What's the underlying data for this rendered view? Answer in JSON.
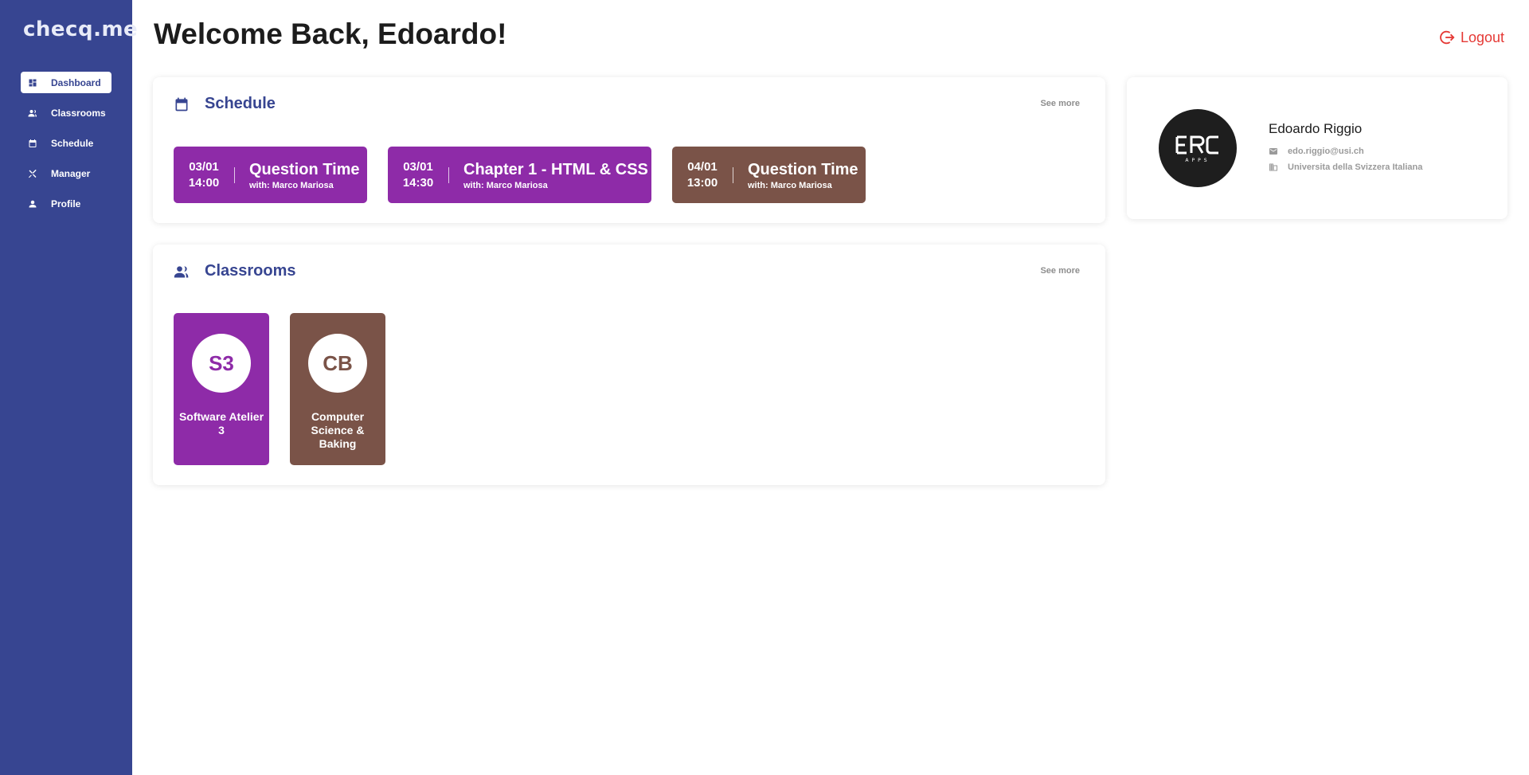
{
  "app": {
    "logo": "checq.me"
  },
  "sidebar": {
    "items": [
      {
        "label": "Dashboard",
        "icon": "dashboard-icon",
        "active": true
      },
      {
        "label": "Classrooms",
        "icon": "people-icon",
        "active": false
      },
      {
        "label": "Schedule",
        "icon": "calendar-icon",
        "active": false
      },
      {
        "label": "Manager",
        "icon": "tools-icon",
        "active": false
      },
      {
        "label": "Profile",
        "icon": "person-icon",
        "active": false
      }
    ]
  },
  "header": {
    "title": "Welcome Back, Edoardo!",
    "logout_label": "Logout"
  },
  "schedule": {
    "title": "Schedule",
    "see_more": "See more",
    "items": [
      {
        "date": "03/01",
        "time": "14:00",
        "name": "Question Time",
        "with": "with: Marco Mariosa",
        "color": "#8e2ba8"
      },
      {
        "date": "03/01",
        "time": "14:30",
        "name": "Chapter 1 - HTML & CSS",
        "with": "with: Marco Mariosa",
        "color": "#8e2ba8"
      },
      {
        "date": "04/01",
        "time": "13:00",
        "name": "Question Time",
        "with": "with: Marco Mariosa",
        "color": "#7a5348"
      }
    ]
  },
  "classrooms": {
    "title": "Classrooms",
    "see_more": "See more",
    "items": [
      {
        "abbr": "S3",
        "name": "Software Atelier 3",
        "color": "#8e2ba8"
      },
      {
        "abbr": "CB",
        "name": "Computer Science & Baking",
        "color": "#7a5348"
      }
    ]
  },
  "profile": {
    "name": "Edoardo Riggio",
    "email": "edo.riggio@usi.ch",
    "institution": "Universita della Svizzera Italiana",
    "avatar_icon": "erc-apps-logo"
  },
  "colors": {
    "sidebar": "#374591",
    "accent": "#374591",
    "logout": "#e53935",
    "purple": "#8e2ba8",
    "brown": "#7a5348"
  }
}
